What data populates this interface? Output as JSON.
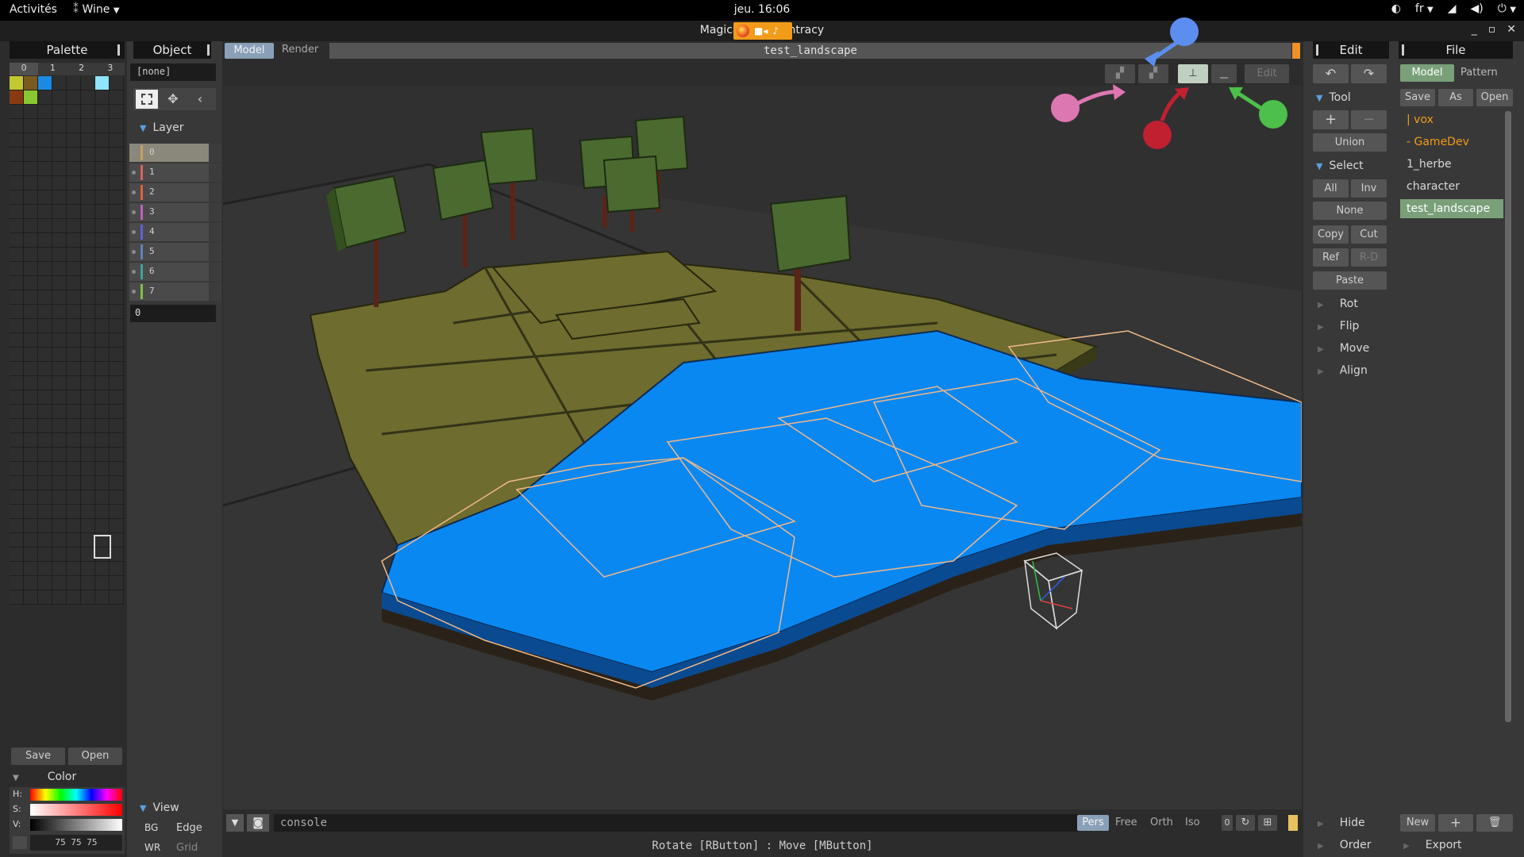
{
  "system_bar": {
    "activities": "Activités",
    "app_name": "Wine",
    "clock": "jeu. 16:06",
    "keyboard_layout": "fr"
  },
  "window": {
    "title": "MagicaVoxel Lightracy"
  },
  "palette": {
    "title": "Palette",
    "tabs": [
      "0",
      "1",
      "2",
      "3"
    ],
    "save_label": "Save",
    "open_label": "Open",
    "swatches": [
      "#c2c832",
      "#7a5a1e",
      "#1a8ae6",
      "#8ee4f8",
      "#8a3a12",
      "#8ac832"
    ]
  },
  "color": {
    "title": "Color",
    "h_label": "H:",
    "s_label": "S:",
    "v_label": "V:",
    "values": "75 75 75"
  },
  "object": {
    "title": "Object",
    "name_value": "[none]",
    "layer_title": "Layer",
    "layers": [
      {
        "name": "0",
        "color": "#c8a060"
      },
      {
        "name": "1",
        "color": "#e06060"
      },
      {
        "name": "2",
        "color": "#e06040"
      },
      {
        "name": "3",
        "color": "#c060c0"
      },
      {
        "name": "4",
        "color": "#6060e0"
      },
      {
        "name": "5",
        "color": "#6080c0"
      },
      {
        "name": "6",
        "color": "#40a0a0"
      },
      {
        "name": "7",
        "color": "#80c040"
      }
    ],
    "layer_value": "0",
    "view_title": "View",
    "view_bg": "BG",
    "view_edge": "Edge",
    "view_wr": "WR",
    "view_grid": "Grid"
  },
  "viewport": {
    "tab_model": "Model",
    "tab_render": "Render",
    "file_name": "test_landscape",
    "edit_label": "Edit",
    "console_placeholder": "console",
    "camera_modes": [
      "Pers",
      "Free",
      "Orth",
      "Iso"
    ],
    "camera_zero": "0",
    "status_hint": "Rotate [RButton] : Move [MButton]",
    "colors": {
      "grass": "#6e6c2e",
      "water": "#0a88f2",
      "trunk": "#5a2418",
      "leaves": "#4a6a30",
      "highlight": "#f0b888"
    }
  },
  "edit": {
    "title": "Edit",
    "tool_title": "Tool",
    "union_label": "Union",
    "select_title": "Select",
    "all": "All",
    "inv": "Inv",
    "none": "None",
    "copy": "Copy",
    "cut": "Cut",
    "ref": "Ref",
    "rd": "R-D",
    "paste": "Paste",
    "rot": "Rot",
    "flip": "Flip",
    "move": "Move",
    "align": "Align",
    "hide": "Hide",
    "order": "Order"
  },
  "file": {
    "title": "File",
    "tab_model": "Model",
    "tab_pattern": "Pattern",
    "save": "Save",
    "as": "As",
    "open": "Open",
    "items": [
      "| vox",
      "- GameDev",
      "1_herbe",
      "character",
      "test_landscape"
    ],
    "new": "New",
    "export": "Export"
  }
}
